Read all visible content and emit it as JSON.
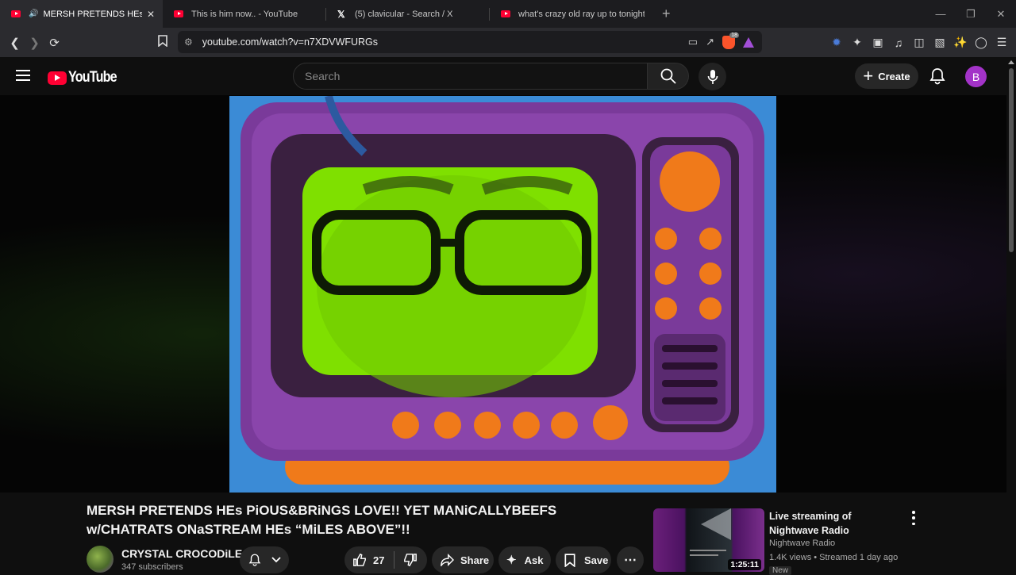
{
  "browser": {
    "tabs": [
      {
        "title": "MERSH PRETENDS HEs PiOUS&BRiNGS LOVE!! YET MANiCALLY",
        "active": true,
        "favicon": "youtube-icon",
        "audio": true
      },
      {
        "title": "This is him now.. - YouTube",
        "active": false,
        "favicon": "youtube-icon"
      },
      {
        "title": "(5) clavicular - Search / X",
        "active": false,
        "favicon": "x-icon"
      },
      {
        "title": "what's crazy old ray up to tonight? (o",
        "active": false,
        "favicon": "youtube-icon"
      }
    ],
    "new_tab_label": "+",
    "url": "youtube.com/watch?v=n7XDVWFURGs",
    "shield_count": "18"
  },
  "youtube": {
    "logo_text": "YouTube",
    "search_placeholder": "Search",
    "create_label": "Create",
    "avatar_letter": "B"
  },
  "video": {
    "title": "MERSH PRETENDS HEs PiOUS&BRiNGS LOVE!! YET MANiCALLYBEEFS w/CHATRATS ONaSTREAM HEs “MiLES ABOVE”!!",
    "channel_name": "CRYSTAL CROCODiLE",
    "subscribers": "347 subscribers",
    "likes": "27",
    "share_label": "Share",
    "ask_label": "Ask",
    "save_label": "Save"
  },
  "recommendations": [
    {
      "title": "Live streaming of Nightwave Radio",
      "channel": "Nightwave Radio",
      "meta": "1.4K views • Streamed 1 day ago",
      "duration": "1:25:11",
      "badge": "New"
    }
  ],
  "colors": {
    "accent_red": "#ff0033",
    "avatar_purple": "#a333c8",
    "tv_purple": "#7a3a9a",
    "tv_orange": "#f07a1a",
    "screen_green": "#7fe000"
  }
}
